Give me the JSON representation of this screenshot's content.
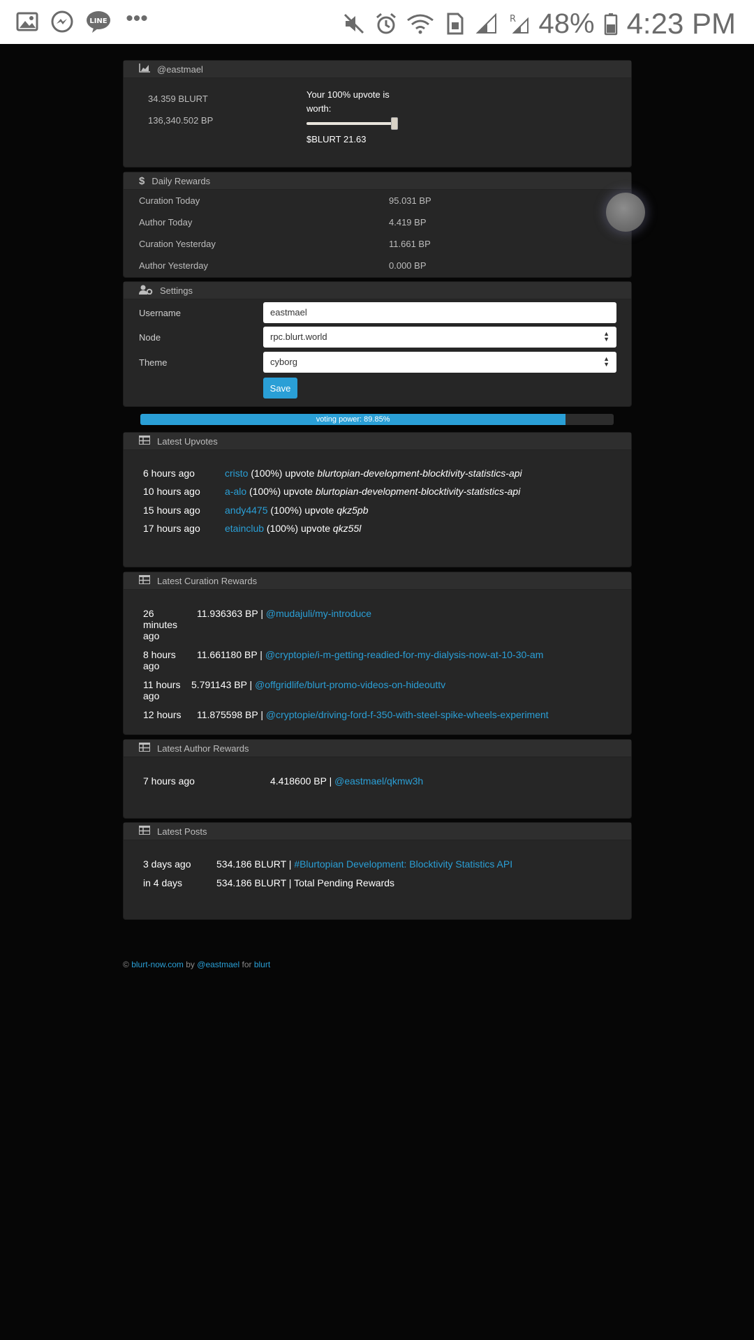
{
  "status_bar": {
    "battery": "48%",
    "time": "4:23 PM"
  },
  "account": {
    "username": "@eastmael",
    "blurt_balance": "34.359 BLURT",
    "bp_balance": "136,340.502 BP",
    "upvote_label": "Your 100% upvote is worth:",
    "upvote_value": "$BLURT 21.63",
    "slider_percent": 100
  },
  "daily_rewards": {
    "title": "Daily Rewards",
    "rows": [
      {
        "label": "Curation Today",
        "value": "95.031 BP"
      },
      {
        "label": "Author Today",
        "value": "4.419 BP"
      },
      {
        "label": "Curation Yesterday",
        "value": "11.661 BP"
      },
      {
        "label": "Author Yesterday",
        "value": "0.000 BP"
      }
    ]
  },
  "settings": {
    "title": "Settings",
    "username_label": "Username",
    "username_value": "eastmael",
    "node_label": "Node",
    "node_value": "rpc.blurt.world",
    "theme_label": "Theme",
    "theme_value": "cyborg",
    "save_label": "Save"
  },
  "voting_power": {
    "label": "voting power: 89.85%",
    "percent": 89.85
  },
  "latest_upvotes": {
    "title": "Latest Upvotes",
    "items": [
      {
        "time": "6 hours ago",
        "user": "cristo",
        "text": " (100%) upvote ",
        "permlink": "blurtopian-development-blocktivity-statistics-api"
      },
      {
        "time": "10 hours ago",
        "user": "a-alo",
        "text": " (100%) upvote ",
        "permlink": "blurtopian-development-blocktivity-statistics-api"
      },
      {
        "time": "15 hours ago",
        "user": "andy4475",
        "text": " (100%) upvote ",
        "permlink": "qkz5pb"
      },
      {
        "time": "17 hours ago",
        "user": "etainclub",
        "text": " (100%) upvote ",
        "permlink": "qkz55l"
      }
    ]
  },
  "latest_curation": {
    "title": "Latest Curation Rewards",
    "items": [
      {
        "time": "26 minutes ago",
        "amount": "11.936363 BP | ",
        "link": "@mudajuli/my-introduce"
      },
      {
        "time": "8 hours ago",
        "amount": "11.661180 BP | ",
        "link": "@cryptopie/i-m-getting-readied-for-my-dialysis-now-at-10-30-am"
      },
      {
        "time": "11 hours ago",
        "amount": "5.791143 BP | ",
        "link": "@offgridlife/blurt-promo-videos-on-hideouttv"
      },
      {
        "time": "12 hours",
        "amount": "11.875598 BP | ",
        "link": "@cryptopie/driving-ford-f-350-with-steel-spike-wheels-experiment"
      }
    ]
  },
  "latest_author": {
    "title": "Latest Author Rewards",
    "items": [
      {
        "time": "7 hours ago",
        "amount": "4.418600 BP | ",
        "link": "@eastmael/qkmw3h"
      }
    ]
  },
  "latest_posts": {
    "title": "Latest Posts",
    "items": [
      {
        "time": "3 days ago",
        "amount": "534.186 BLURT | ",
        "link": "#Blurtopian Development: Blocktivity Statistics API",
        "text": ""
      },
      {
        "time": "in 4 days",
        "amount": "534.186 BLURT | ",
        "link": "",
        "text": "Total Pending Rewards"
      }
    ]
  },
  "footer": {
    "copyright": "©",
    "site": "blurt-now.com",
    "by": "by",
    "author": "@eastmael",
    "for": "for",
    "chain": "blurt"
  },
  "colors": {
    "accent": "#2a9fd6",
    "background": "#060606",
    "card": "#262626"
  }
}
